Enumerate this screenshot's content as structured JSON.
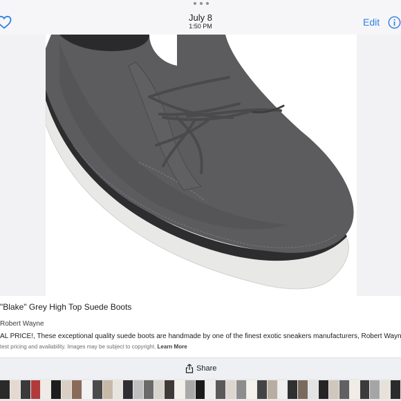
{
  "header": {
    "date": "July 8",
    "time": "1:50 PM",
    "edit_label": "Edit",
    "favorite_icon": "heart-icon",
    "info_icon": "info-icon",
    "accent_color": "#2f7ee4"
  },
  "photo": {
    "subject": "grey suede chukka boot with laces",
    "colors": {
      "suede": "#5c5c5e",
      "sole": "#e8e8e6",
      "lace": "#4a4a4c"
    }
  },
  "lookup": {
    "title": "\"Blake\" Grey High Top Suede Boots",
    "brand": "Robert Wayne",
    "description": "AL PRICE!, These exceptional quality suede boots are handmade by one of the finest exotic sneakers manufacturers, Robert Wayne",
    "disclaimer": "test pricing and availability. Images may be subject to copyright.",
    "learn_more": "Learn More"
  },
  "share": {
    "label": "Share",
    "icon": "share-icon"
  },
  "thumbnails": {
    "colors": [
      "#2a2a2a",
      "#e4d9cf",
      "#3a3a3a",
      "#b23a3a",
      "#f0ebe6",
      "#1e1e1e",
      "#d9cfc3",
      "#8a6b5a",
      "#f2f2f2",
      "#4b4b4b",
      "#c7b8a8",
      "#e8e3dc",
      "#2e2e33",
      "#bfbfbf",
      "#6a6a6a",
      "#d7d3cd",
      "#3f3a36",
      "#f3efe9",
      "#a9a9a9",
      "#1b1b1b",
      "#eeeeee",
      "#5a5a5a",
      "#dcd6ce",
      "#8d8d8d",
      "#f5f1eb",
      "#444444",
      "#b9ada0",
      "#efefef",
      "#303030",
      "#7a6a5d",
      "#e3e3e3",
      "#252525",
      "#cfc6bc",
      "#616161",
      "#f1ece6",
      "#3b3b3b",
      "#a5a5a5",
      "#e7e1da",
      "#2b2b2b"
    ]
  }
}
